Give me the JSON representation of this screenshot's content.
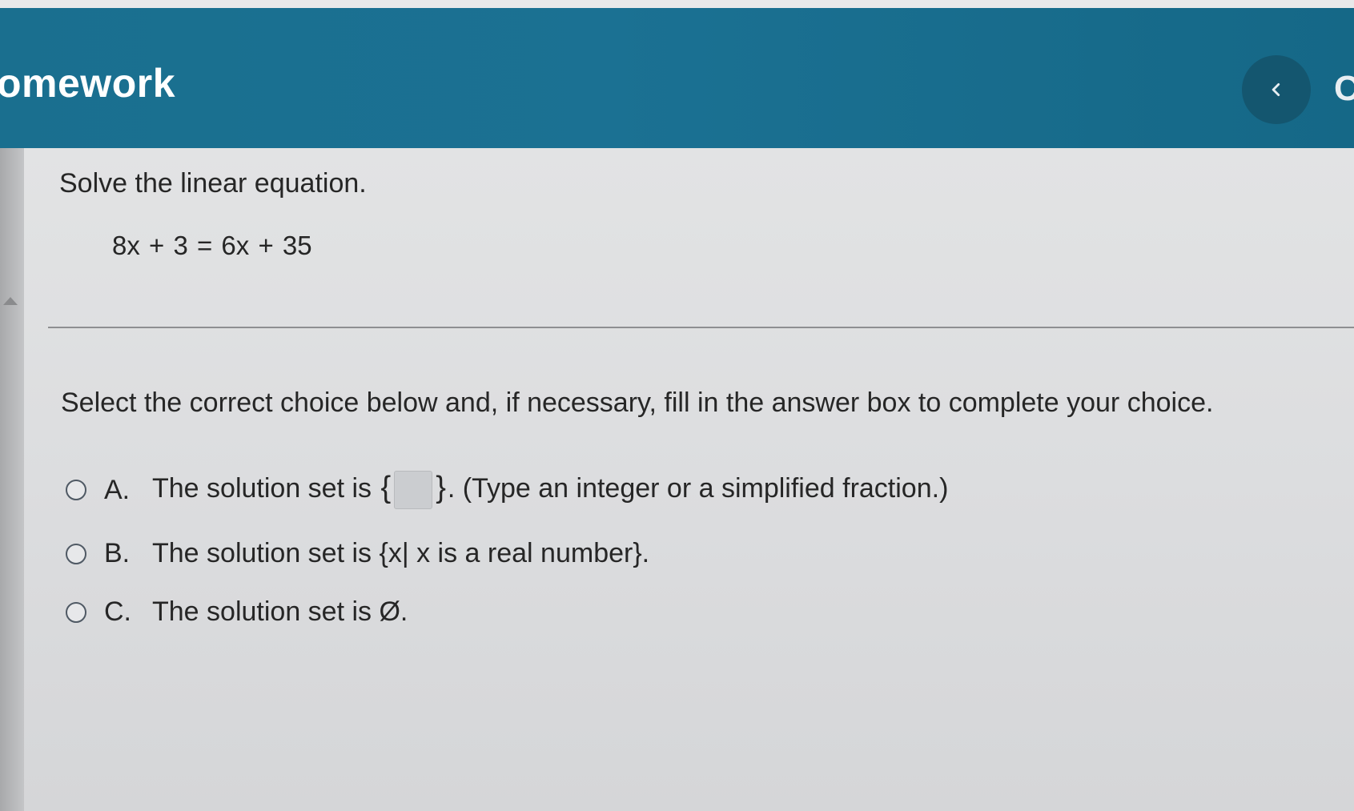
{
  "header": {
    "title": "omework",
    "next_partial": "C"
  },
  "question": {
    "title": "Solve the linear equation.",
    "equation": "8x + 3 = 6x + 35",
    "instruction": "Select the correct choice below and, if necessary, fill in the answer box to complete your choice."
  },
  "choices": [
    {
      "letter": "A.",
      "text_before": "The solution set is",
      "brace_open": "{",
      "brace_close": "}",
      "text_after": ". (Type an integer or a simplified fraction.)",
      "answer_value": ""
    },
    {
      "letter": "B.",
      "text": "The solution set is {x| x is a real number}."
    },
    {
      "letter": "C.",
      "text": "The solution set is Ø."
    }
  ],
  "icons": {
    "prev": "chevron-left-icon"
  },
  "colors": {
    "header": "#1b7193",
    "prev_button": "#14566f",
    "text": "#262626"
  }
}
